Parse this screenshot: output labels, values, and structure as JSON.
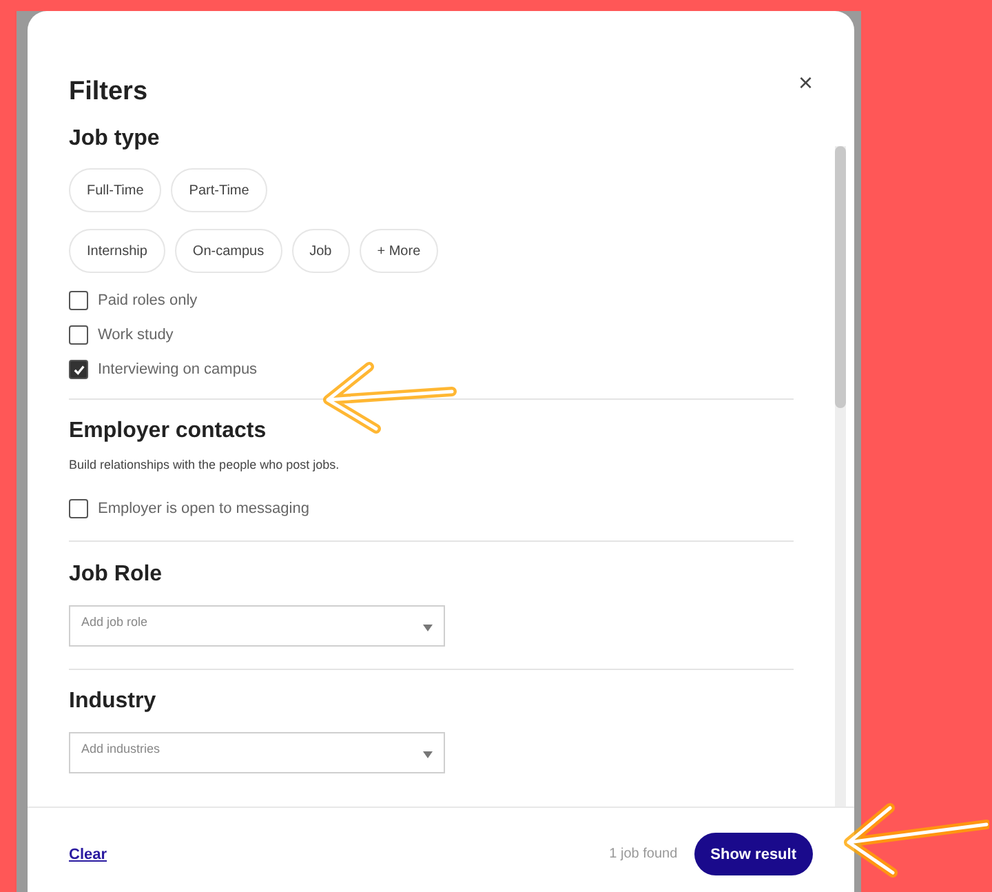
{
  "dialog": {
    "title": "Filters",
    "close": "×"
  },
  "job_type": {
    "title": "Job type",
    "chip_rows": [
      [
        {
          "label": "Full-Time",
          "selected": false
        },
        {
          "label": "Part-Time",
          "selected": false
        }
      ],
      [
        {
          "label": "Internship",
          "selected": false
        },
        {
          "label": "On-campus",
          "selected": false
        },
        {
          "label": "Job",
          "selected": false
        },
        {
          "label": "+ More",
          "selected": false
        }
      ]
    ],
    "options": [
      {
        "label": "Paid roles only",
        "checked": false
      },
      {
        "label": "Work study",
        "checked": false
      },
      {
        "label": "Interviewing on campus",
        "checked": true
      }
    ]
  },
  "employer_contacts": {
    "title": "Employer contacts",
    "description": "Build relationships with the people who post jobs.",
    "options": [
      {
        "label": "Employer is open to messaging",
        "checked": false
      }
    ]
  },
  "job_role": {
    "title": "Job Role",
    "placeholder": "Add job role"
  },
  "industry": {
    "title": "Industry",
    "placeholder": "Add industries"
  },
  "footer": {
    "clear": "Clear",
    "count": "1 job found",
    "submit": "Show result"
  }
}
